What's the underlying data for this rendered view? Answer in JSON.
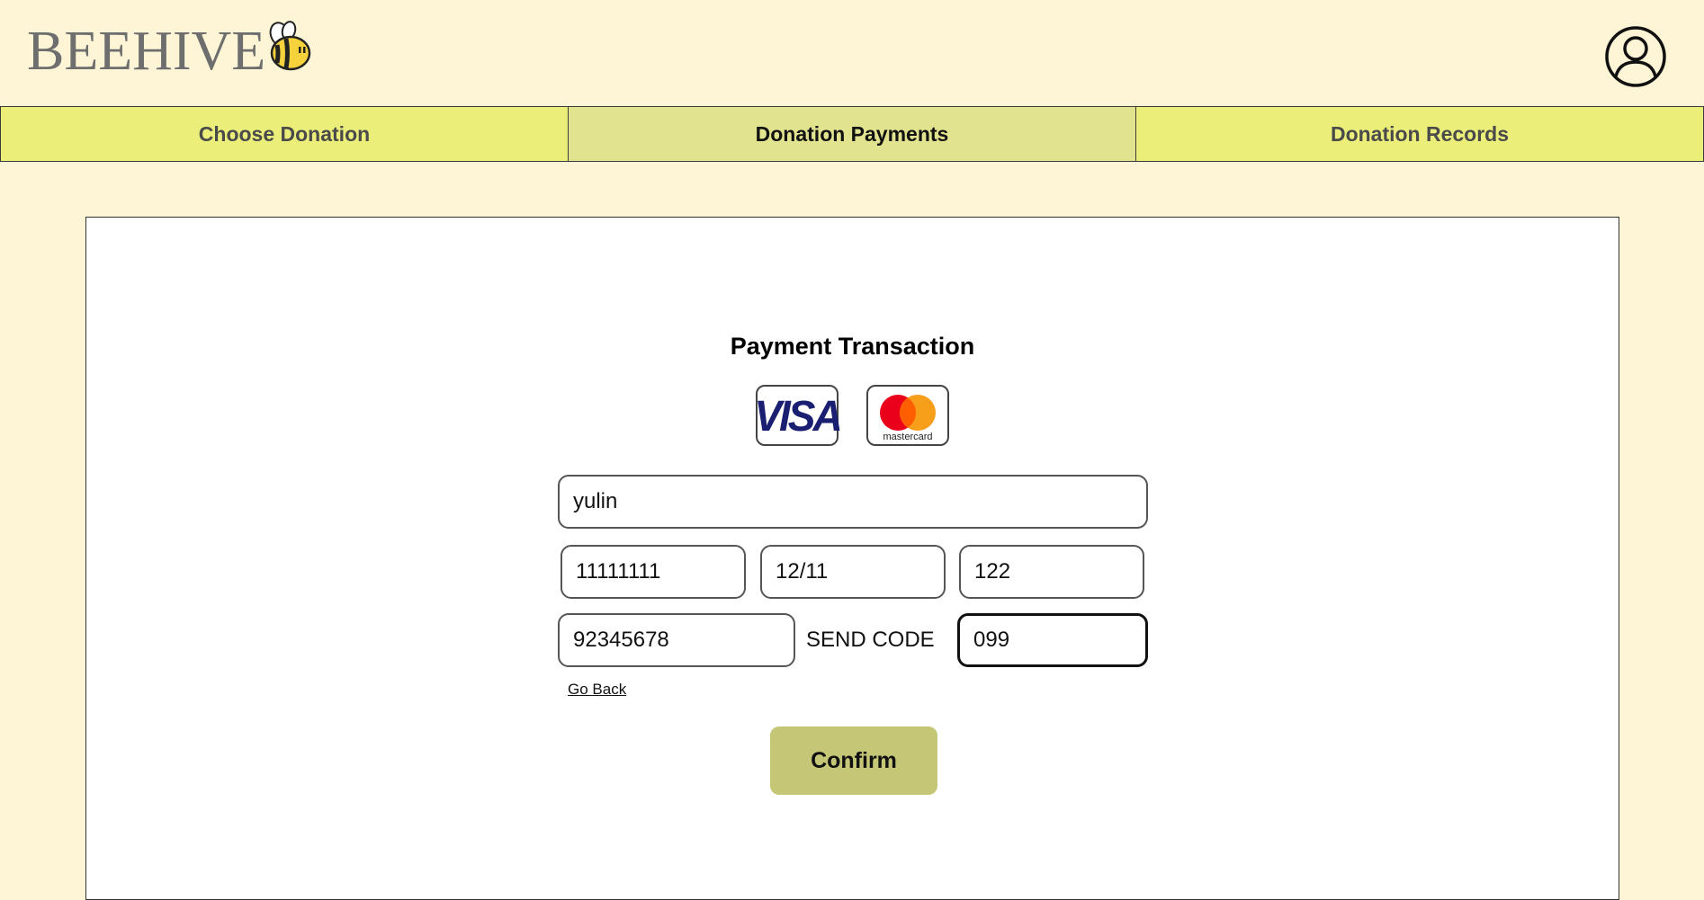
{
  "header": {
    "logo_text": "BEEHIVE",
    "logo_icon": "bee-icon",
    "profile_icon": "user-avatar-icon"
  },
  "nav": {
    "tabs": [
      {
        "label": "Choose Donation",
        "active": false
      },
      {
        "label": "Donation Payments",
        "active": true
      },
      {
        "label": "Donation Records",
        "active": false
      }
    ]
  },
  "payment": {
    "title": "Payment Transaction",
    "brands": {
      "visa": "VISA",
      "mastercard": "mastercard"
    },
    "fields": {
      "name": "yulin",
      "card_number": "11111111",
      "expiry": "12/11",
      "cvv": "122",
      "phone": "92345678",
      "code": "099"
    },
    "send_code_label": "SEND CODE",
    "go_back_label": "Go Back",
    "confirm_label": "Confirm"
  },
  "colors": {
    "page_bg": "#fdf5d6",
    "tab_bg": "#ebef7a",
    "tab_active_bg": "#e2e38e",
    "confirm_bg": "#c5c777"
  }
}
